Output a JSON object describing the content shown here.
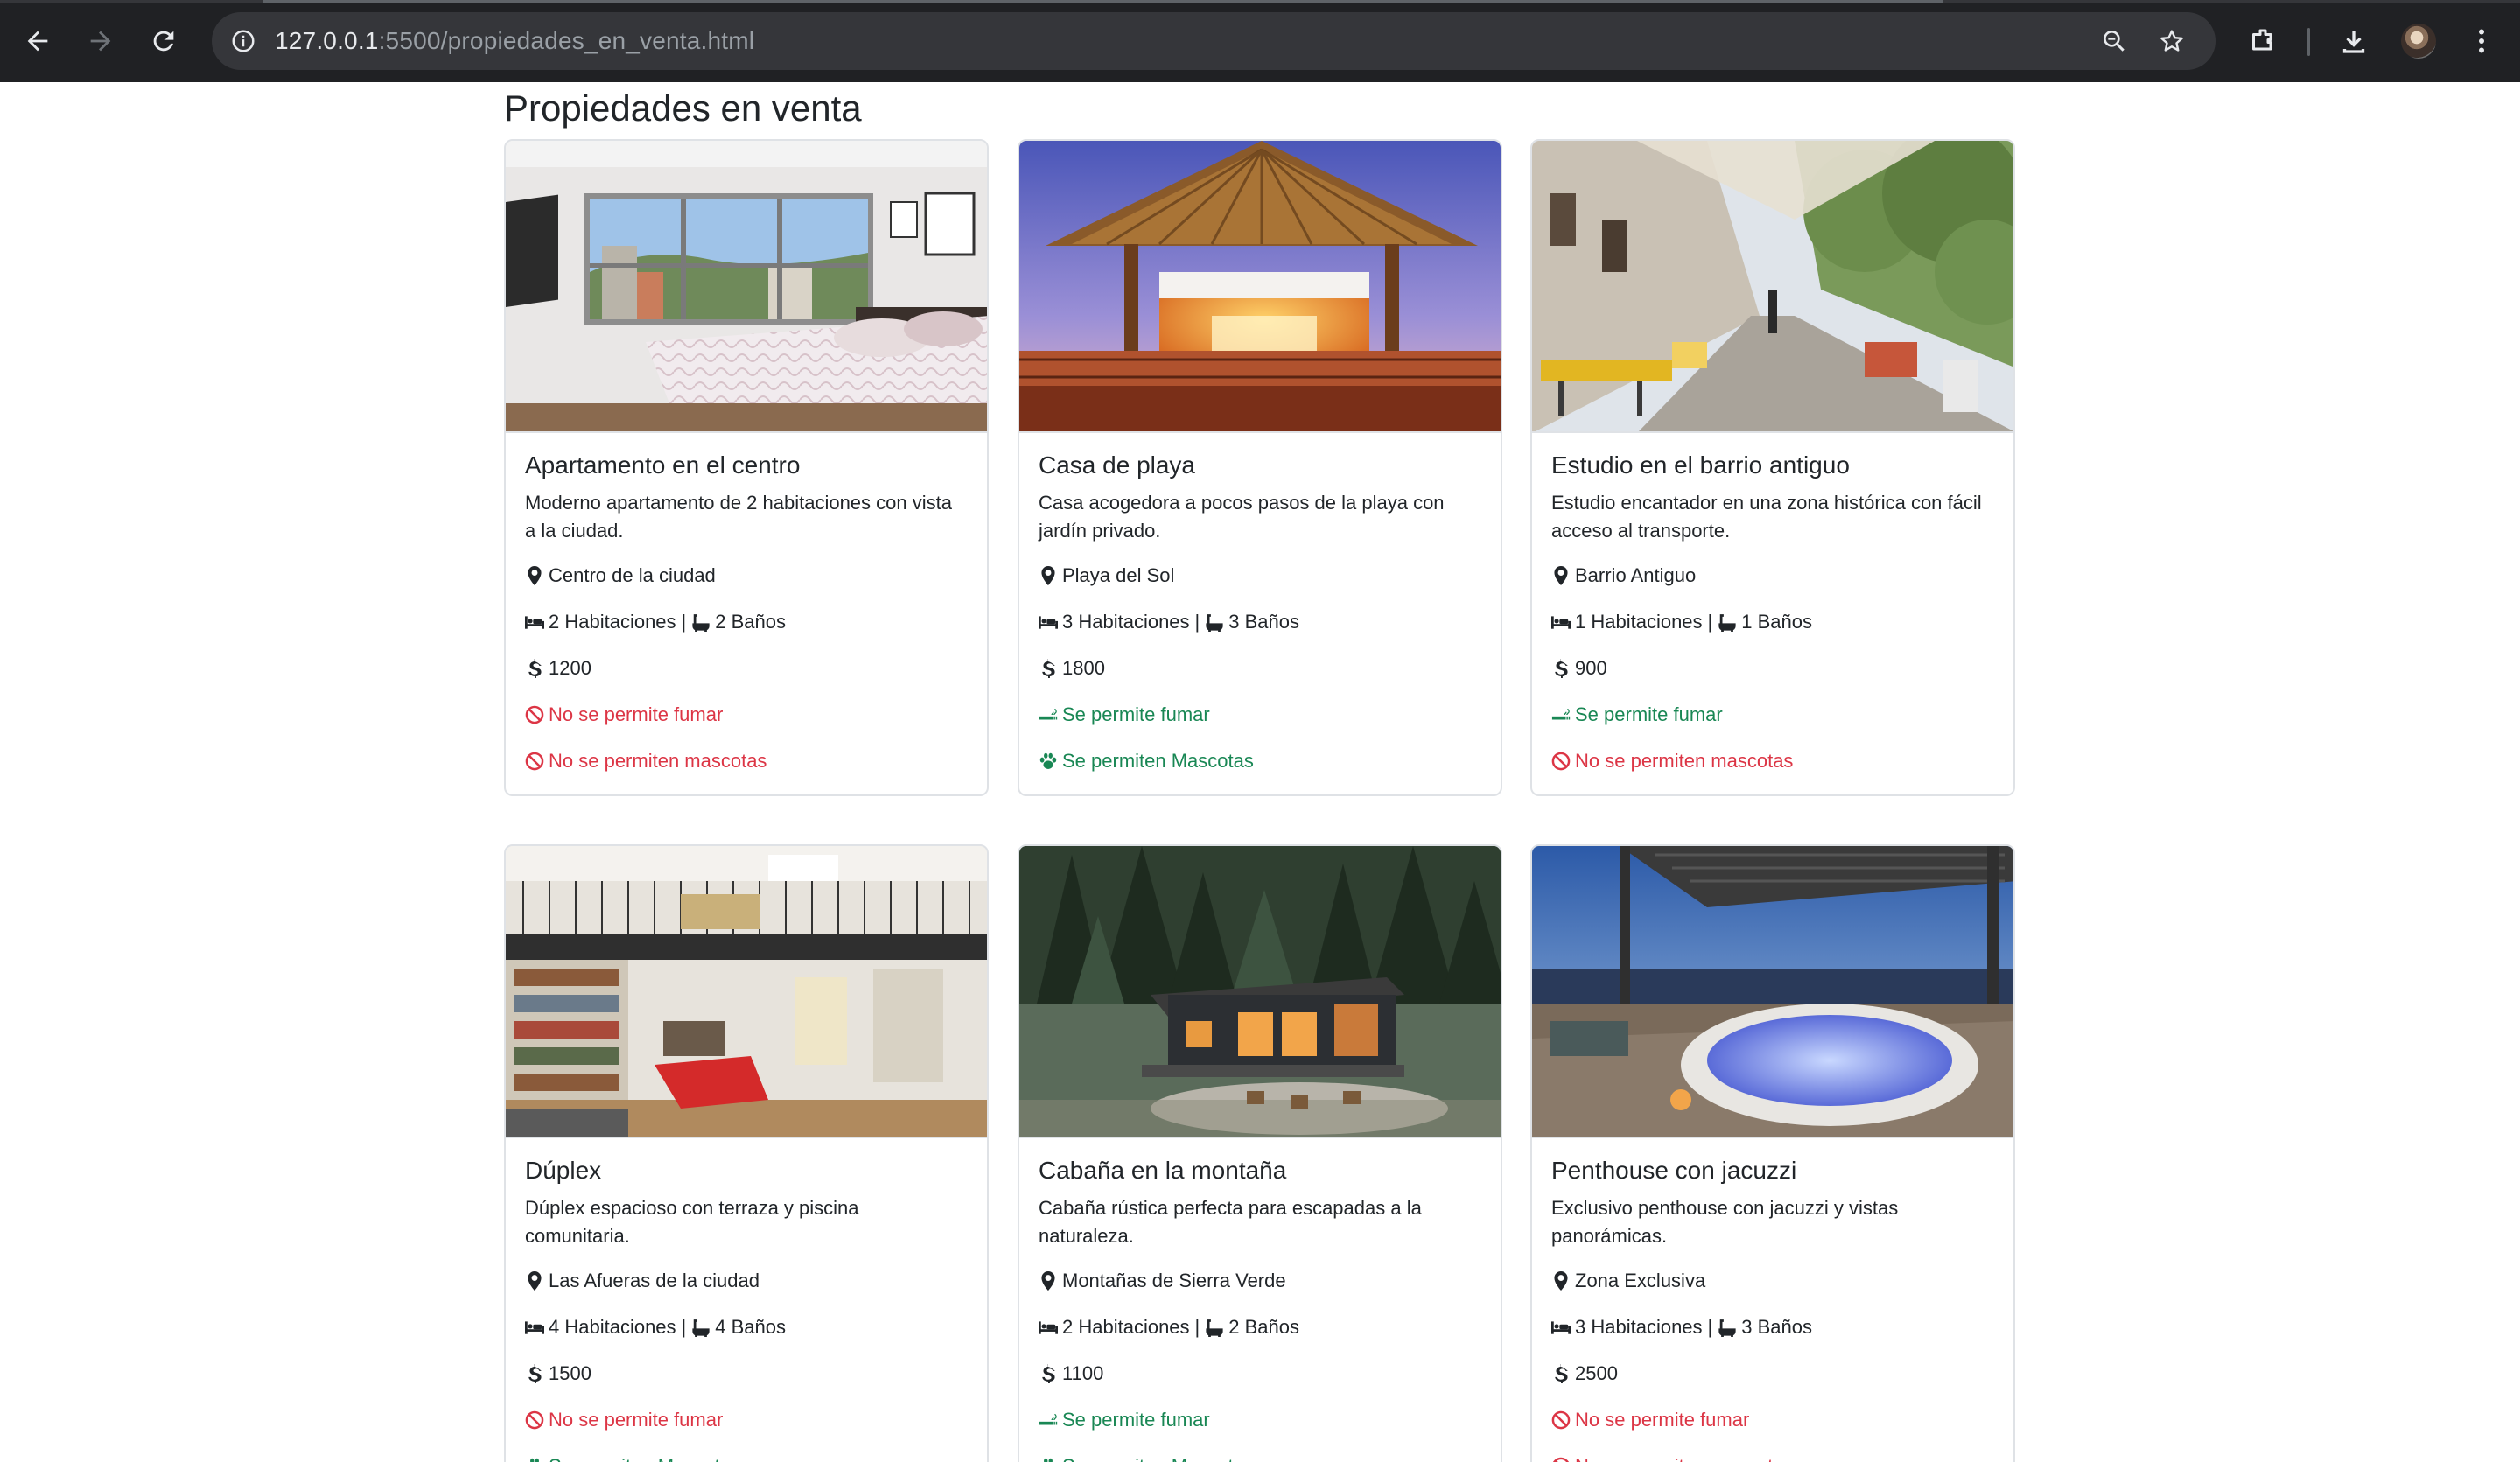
{
  "browser": {
    "url_host": "127.0.0.1",
    "url_path": ":5500/propiedades_en_venta.html",
    "icons": [
      "back-arrow-icon",
      "forward-arrow-icon",
      "reload-icon",
      "site-info-icon",
      "zoom-icon",
      "bookmark-star-icon",
      "extensions-icon",
      "download-icon",
      "profile-avatar",
      "menu-dots-icon"
    ]
  },
  "page": {
    "title": "Propiedades en venta"
  },
  "colors": {
    "allowed": "#198754",
    "not_allowed": "#dc3545"
  },
  "properties": [
    {
      "title": "Apartamento en el centro",
      "description": "Moderno apartamento de 2 habitaciones con vista a la ciudad.",
      "location": "Centro de la ciudad",
      "rooms": "2 Habitaciones",
      "baths": "2 Baños",
      "price": "1200",
      "smoking": "No se permite fumar",
      "smoking_allowed": false,
      "pets": "No se permiten mascotas",
      "pets_allowed": false,
      "image": "bedroom"
    },
    {
      "title": "Casa de playa",
      "description": "Casa acogedora a pocos pasos de la playa con jardín privado.",
      "location": "Playa del Sol",
      "rooms": "3 Habitaciones",
      "baths": "3 Baños",
      "price": "1800",
      "smoking": "Se permite fumar",
      "smoking_allowed": true,
      "pets": "Se permiten Mascotas",
      "pets_allowed": true,
      "image": "beach-house"
    },
    {
      "title": "Estudio en el barrio antiguo",
      "description": "Estudio encantador en una zona histórica con fácil acceso al transporte.",
      "location": "Barrio Antiguo",
      "rooms": "1 Habitaciones",
      "baths": "1 Baños",
      "price": "900",
      "smoking": "Se permite fumar",
      "smoking_allowed": true,
      "pets": "No se permiten mascotas",
      "pets_allowed": false,
      "image": "old-street"
    },
    {
      "title": "Dúplex",
      "description": "Dúplex espacioso con terraza y piscina comunitaria.",
      "location": "Las Afueras de la ciudad",
      "rooms": "4 Habitaciones",
      "baths": "4 Baños",
      "price": "1500",
      "smoking": "No se permite fumar",
      "smoking_allowed": false,
      "pets": "Se permiten Mascotas",
      "pets_allowed": true,
      "image": "loft"
    },
    {
      "title": "Cabaña en la montaña",
      "description": "Cabaña rústica perfecta para escapadas a la naturaleza.",
      "location": "Montañas de Sierra Verde",
      "rooms": "2 Habitaciones",
      "baths": "2 Baños",
      "price": "1100",
      "smoking": "Se permite fumar",
      "smoking_allowed": true,
      "pets": "Se permiten Mascotas",
      "pets_allowed": true,
      "image": "cabin"
    },
    {
      "title": "Penthouse con jacuzzi",
      "description": "Exclusivo penthouse con jacuzzi y vistas panorámicas.",
      "location": "Zona Exclusiva",
      "rooms": "3 Habitaciones",
      "baths": "3 Baños",
      "price": "2500",
      "smoking": "No se permite fumar",
      "smoking_allowed": false,
      "pets": "No se permiten mascotas",
      "pets_allowed": false,
      "image": "jacuzzi"
    }
  ]
}
